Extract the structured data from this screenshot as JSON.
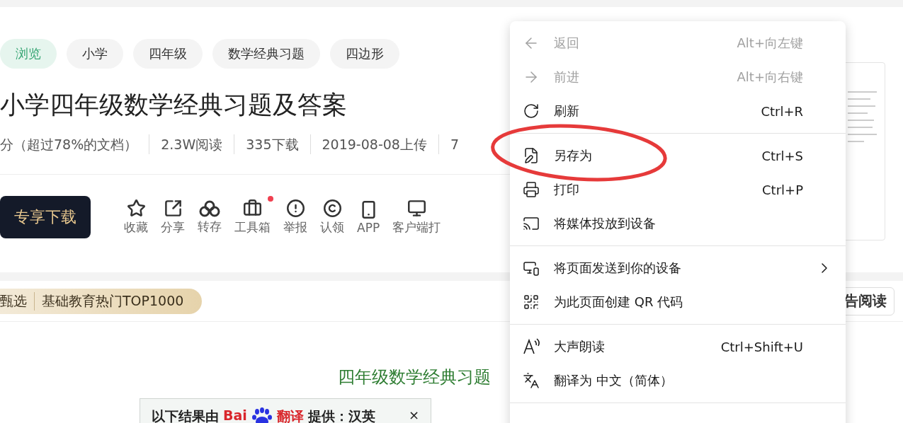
{
  "tags": [
    {
      "label": "浏览",
      "selected": true
    },
    {
      "label": "小学",
      "selected": false
    },
    {
      "label": "四年级",
      "selected": false
    },
    {
      "label": "数学经典习题",
      "selected": false
    },
    {
      "label": "四边形",
      "selected": false
    }
  ],
  "title": "小学四年级数学经典习题及答案",
  "meta": [
    "分（超过78%的文档）",
    "2.3W阅读",
    "335下载",
    "2019-08-08上传",
    "7"
  ],
  "download_button": "专享下载",
  "actions": [
    {
      "label": "收藏",
      "kind": "star",
      "badge": false
    },
    {
      "label": "分享",
      "kind": "share",
      "badge": false
    },
    {
      "label": "转存",
      "kind": "cloud",
      "badge": false
    },
    {
      "label": "工具箱",
      "kind": "toolbox",
      "badge": true
    },
    {
      "label": "举报",
      "kind": "alert",
      "badge": false
    },
    {
      "label": "认领",
      "kind": "copyright",
      "badge": false
    },
    {
      "label": "APP",
      "kind": "phone",
      "badge": false
    },
    {
      "label": "客户端打",
      "kind": "monitor",
      "badge": false
    }
  ],
  "collection_badge": [
    "甄选",
    "基础教育热门TOP1000"
  ],
  "read_button": "告阅读",
  "doc_heading": "四年级数学经典习题",
  "translate_box": {
    "prefix": "以下结果由",
    "logo_left": "Bai",
    "logo_right": "翻译",
    "suffix": "提供：汉英",
    "close": "×"
  },
  "context_menu": {
    "groups": [
      [
        {
          "label": "返回",
          "shortcut": "Alt+向左键",
          "kind": "back",
          "disabled": true,
          "submenu": false
        },
        {
          "label": "前进",
          "shortcut": "Alt+向右键",
          "kind": "forward",
          "disabled": true,
          "submenu": false
        },
        {
          "label": "刷新",
          "shortcut": "Ctrl+R",
          "kind": "refresh",
          "disabled": false,
          "submenu": false
        }
      ],
      [
        {
          "label": "另存为",
          "shortcut": "Ctrl+S",
          "kind": "save",
          "disabled": false,
          "submenu": false
        },
        {
          "label": "打印",
          "shortcut": "Ctrl+P",
          "kind": "print",
          "disabled": false,
          "submenu": false
        },
        {
          "label": "将媒体投放到设备",
          "kind": "cast",
          "disabled": false,
          "submenu": false
        }
      ],
      [
        {
          "label": "将页面发送到你的设备",
          "kind": "devices",
          "disabled": false,
          "submenu": true
        },
        {
          "label": "为此页面创建 QR 代码",
          "kind": "qr",
          "disabled": false,
          "submenu": false
        }
      ],
      [
        {
          "label": "大声朗读",
          "shortcut": "Ctrl+Shift+U",
          "kind": "read",
          "disabled": false,
          "submenu": false
        },
        {
          "label": "翻译为 中文（简体）",
          "kind": "translate",
          "disabled": false,
          "submenu": false
        }
      ]
    ]
  }
}
